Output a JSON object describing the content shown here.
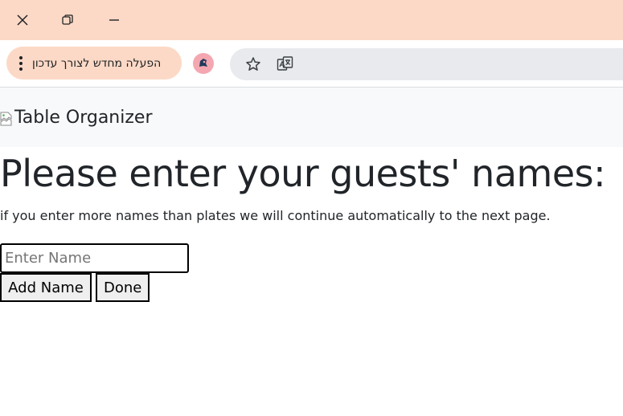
{
  "window_controls": {
    "close_icon": "close-icon",
    "restore_icon": "restore-icon",
    "minimize_icon": "minimize-icon"
  },
  "browser": {
    "update_chip": {
      "label": "הפעלה מחדש לצורך עדכון",
      "icon": "kebab-menu-icon"
    },
    "profile_icon": "profile-avatar-icon",
    "bookmark_icon": "star-icon",
    "translate_icon": "translate-icon",
    "colors": {
      "titlebar": "#fcd9c6",
      "omnibox": "#e8eaed"
    }
  },
  "header": {
    "logo_alt": "Table Organizer"
  },
  "main": {
    "title": "Please enter your guests' names:",
    "subtitle": "if you enter more names than plates we will continue automatically to the next page.",
    "name_input": {
      "value": "",
      "placeholder": "Enter Name"
    },
    "add_button": "Add Name",
    "done_button": "Done"
  }
}
